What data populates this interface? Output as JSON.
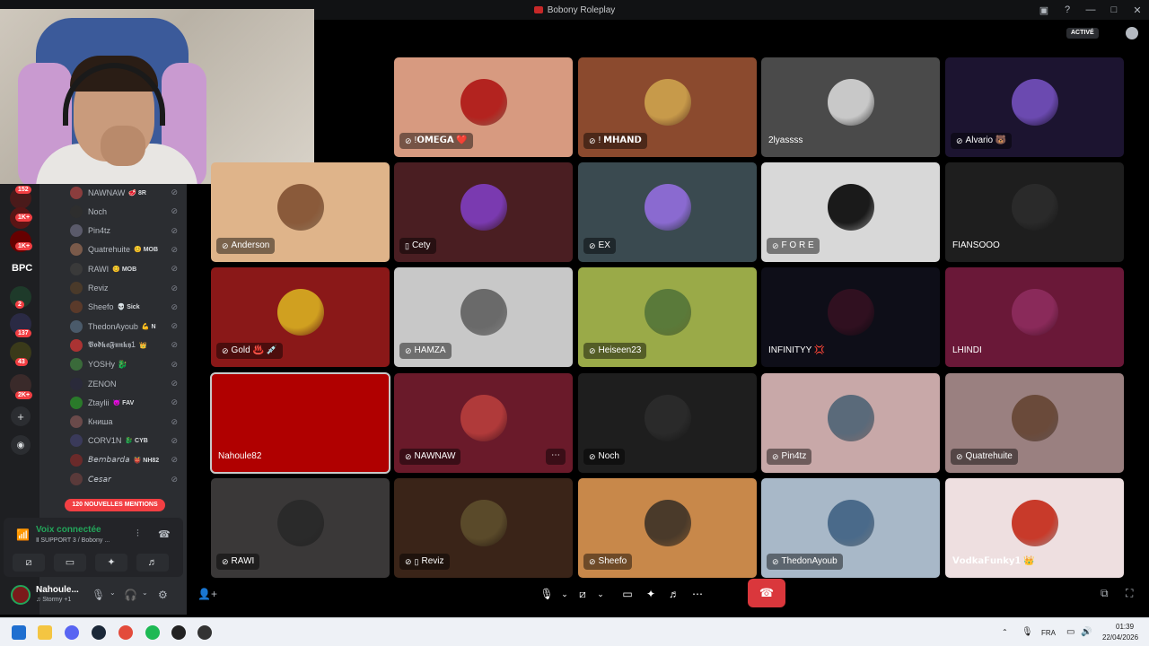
{
  "window": {
    "title": "Bobony Roleplay"
  },
  "header": {
    "active_badge": "ACTIVÉ"
  },
  "rail": {
    "badges": [
      "152",
      "1K+",
      "1K+",
      "2",
      "137",
      "43",
      "2K+"
    ],
    "server_label": "BPC",
    "add_icon": "plus-icon",
    "discover_icon": "compass-icon"
  },
  "members": [
    {
      "name": "NAWNAW",
      "tag": "🥩 8R",
      "color": "#8a3d3d"
    },
    {
      "name": "Noch",
      "tag": "",
      "color": "#2e2e2e"
    },
    {
      "name": "Pin4tz",
      "tag": "",
      "color": "#5a5a6a"
    },
    {
      "name": "Quatrehuite",
      "tag": "😊 MOB",
      "color": "#7a5a4a"
    },
    {
      "name": "RAWI",
      "tag": "😊 MOB",
      "color": "#3a3a3a"
    },
    {
      "name": "Reviz",
      "tag": "",
      "color": "#4a3a2a"
    },
    {
      "name": "Sheefo",
      "tag": "💀 Sick",
      "color": "#5a3a2a"
    },
    {
      "name": "ThedonAyoub",
      "tag": "💪 N",
      "color": "#4a5a6a"
    },
    {
      "name": "𝖁𝖔𝖉𝖐𝖆𝕱𝖚𝖓𝖐𝖞1",
      "tag": "👑",
      "color": "#aa3333"
    },
    {
      "name": "YOSHy 🐉",
      "tag": "",
      "color": "#3a6a3a"
    },
    {
      "name": "ZENON",
      "tag": "",
      "color": "#2a2a3a"
    },
    {
      "name": "Ztaylii",
      "tag": "😈 FAV",
      "color": "#2a7a2a"
    },
    {
      "name": "Книша",
      "tag": "",
      "color": "#6a4a4a"
    },
    {
      "name": "CORV1N",
      "tag": "🐉 CYB",
      "color": "#3a3a5a"
    },
    {
      "name": "𝘉𝘦𝘮𝘣𝘢𝘳𝘥𝘢",
      "tag": "👹 NH82",
      "color": "#6a2a2a"
    },
    {
      "name": "𝘊𝘦𝘴𝘢𝘳",
      "tag": "",
      "color": "#5a3a3a"
    }
  ],
  "mentions_pill": "120 NOUVELLES MENTIONS",
  "voice": {
    "status": "Voix connectée",
    "channel": "Ⅱ SUPPORT 3 / Bobony ...",
    "signal_icon": "signal-icon",
    "buttons": [
      "camera-off-icon",
      "screen-share-icon",
      "activities-icon",
      "soundboard-icon"
    ]
  },
  "user": {
    "name": "Nahoule...",
    "status": "♫ Stormy +1"
  },
  "tiles": [
    {
      "name": "!𝗢𝗠𝗘𝗚𝗔 ❤️",
      "bg": "#d79a80",
      "avatar": "#b3231f",
      "muted": true
    },
    {
      "name": "! 𝗠𝗛𝗔𝗡𝗗",
      "bg": "#8b4a2e",
      "avatar": "#c79a4a",
      "muted": true
    },
    {
      "name": "2lyassss",
      "bg": "#4a4a4a",
      "avatar": "#c8c8c8",
      "muted": false
    },
    {
      "name": "Alvario 🐻",
      "bg": "#1c1430",
      "avatar": "#6b4ab0",
      "muted": true
    },
    {
      "name": "Anderson",
      "bg": "#dfb48a",
      "avatar": "#8a5a3a",
      "muted": true
    },
    {
      "name": "Cety",
      "bg": "#4a1e22",
      "avatar": "#7a3ab0",
      "muted": false,
      "phone": true
    },
    {
      "name": "EX",
      "bg": "#3a4a50",
      "avatar": "#8a6ad0",
      "muted": true
    },
    {
      "name": "F O R E",
      "bg": "#d8d8d8",
      "avatar": "#1a1a1a",
      "muted": true
    },
    {
      "name": "FIANSOOO",
      "bg": "#1e1e1e",
      "avatar": "#2a2a2a",
      "muted": false
    },
    {
      "name": "Gold ♨️ 💉",
      "bg": "#8a1818",
      "avatar": "#d0a020",
      "muted": true
    },
    {
      "name": "HAMZA",
      "bg": "#c8c8c8",
      "avatar": "#6a6a6a",
      "muted": true
    },
    {
      "name": "Heiseen23",
      "bg": "#9aaa48",
      "avatar": "#5a7a3a",
      "muted": true
    },
    {
      "name": "INFINITYY 💢",
      "bg": "#0e0e18",
      "avatar": "#301020",
      "muted": false
    },
    {
      "name": "LHINDI",
      "bg": "#6a1838",
      "avatar": "#8a2a5a",
      "muted": false
    },
    {
      "name": "Nahoule82",
      "bg": "#b00000",
      "avatar": "#b00000",
      "muted": false,
      "selected": true
    },
    {
      "name": "NAWNAW",
      "bg": "#6a1a2a",
      "avatar": "#b03a3a",
      "muted": true,
      "more": true
    },
    {
      "name": "Noch",
      "bg": "#1e1e1e",
      "avatar": "#2a2a2a",
      "muted": true
    },
    {
      "name": "Pin4tz",
      "bg": "#c8a8a8",
      "avatar": "#5a6a7a",
      "muted": true
    },
    {
      "name": "Quatrehuite",
      "bg": "#9a8080",
      "avatar": "#6a4a3a",
      "muted": true
    },
    {
      "name": "RAWI",
      "bg": "#3a3838",
      "avatar": "#2a2a2a",
      "muted": true
    },
    {
      "name": "Reviz",
      "bg": "#3a2418",
      "avatar": "#5a4a2a",
      "muted": true,
      "phone": true
    },
    {
      "name": "Sheefo",
      "bg": "#c8884a",
      "avatar": "#4a3a2a",
      "muted": true
    },
    {
      "name": "ThedonAyoub",
      "bg": "#a8b8c8",
      "avatar": "#4a6a8a",
      "muted": true
    },
    {
      "name": "𝗩𝗼𝗱𝗸𝗮𝗙𝘂𝗻𝗸𝘆𝟭 👑",
      "bg": "#eedfe0",
      "avatar": "#c83a2a",
      "muted": false
    }
  ],
  "controls": {
    "mic": "microphone-icon",
    "camera": "camera-off-icon",
    "share": "screen-share-icon",
    "activities": "activities-icon",
    "soundboard": "soundboard-icon",
    "more": "more-icon",
    "hangup": "hangup-icon"
  },
  "taskbar": {
    "lang": "FRA",
    "time": "01:39",
    "date": "22/04/2026"
  },
  "colors": {
    "accent": "#5865f2",
    "green": "#23a55a",
    "red": "#da373c"
  }
}
